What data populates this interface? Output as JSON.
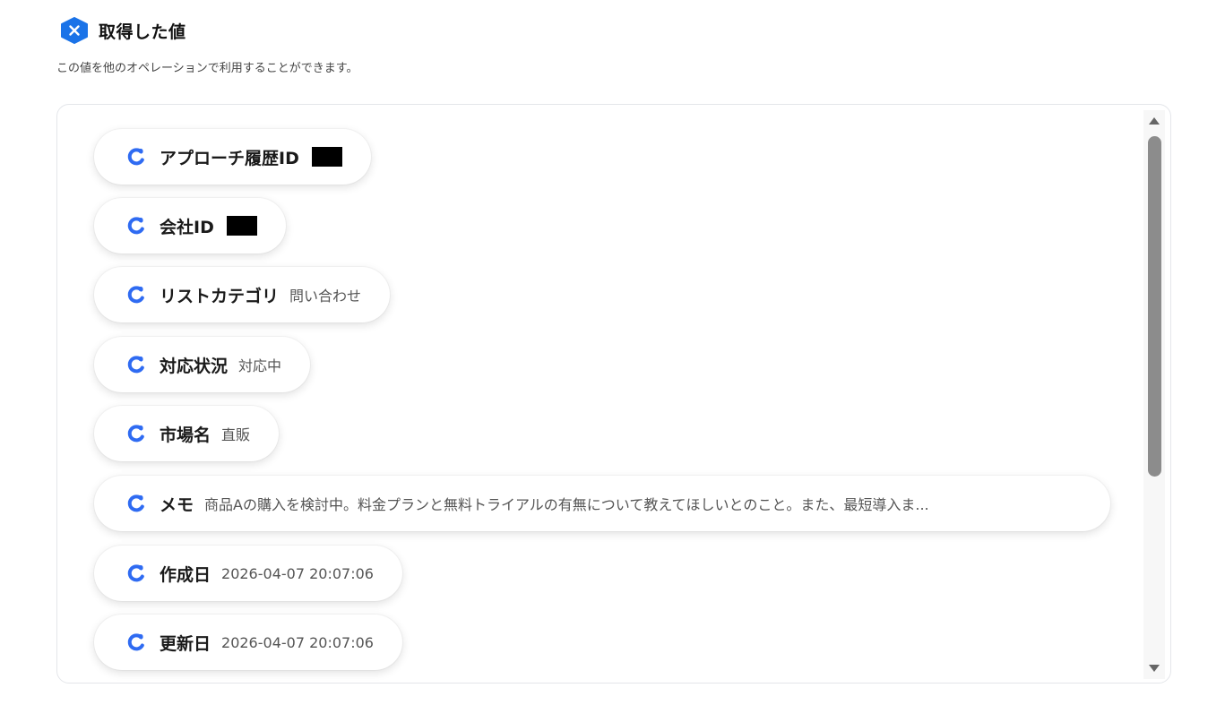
{
  "header": {
    "title": "取得した値",
    "icon": "close-hexagon-icon",
    "accent": "#1a73e8"
  },
  "subtitle": "この値を他のオペレーションで利用することができます。",
  "items": [
    {
      "key": "アプローチ履歴ID",
      "value": "",
      "redacted": true
    },
    {
      "key": "会社ID",
      "value": "",
      "redacted": true
    },
    {
      "key": "リストカテゴリ",
      "value": "問い合わせ"
    },
    {
      "key": "対応状況",
      "value": "対応中"
    },
    {
      "key": "市場名",
      "value": "直販"
    },
    {
      "key": "メモ",
      "value": "商品Aの購入を検討中。料金プランと無料トライアルの有無について教えてほしいとのこと。また、最短導入ま..."
    },
    {
      "key": "作成日",
      "value": "2026-04-07 20:07:06"
    },
    {
      "key": "更新日",
      "value": "2026-04-07 20:07:06"
    }
  ],
  "item_icon": "link-c-icon",
  "icon_color": "#2f6bf2"
}
